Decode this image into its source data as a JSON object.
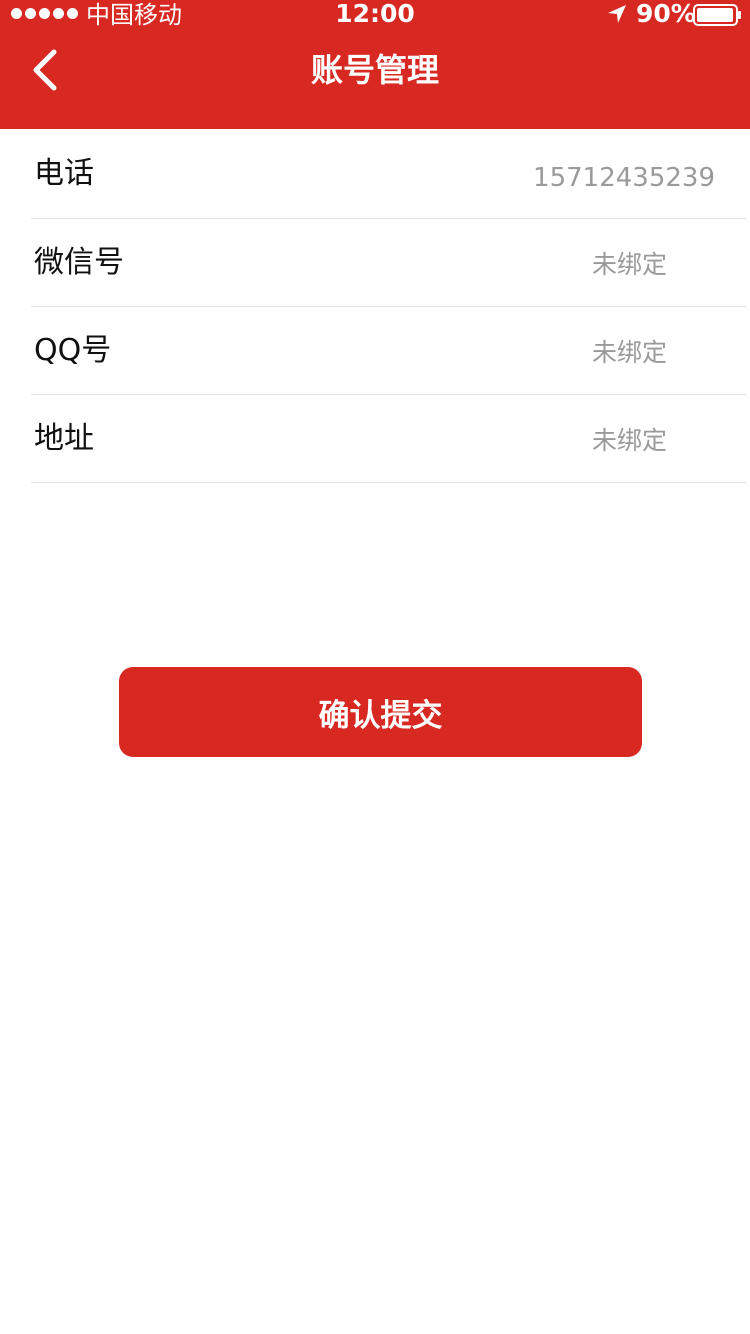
{
  "status_bar": {
    "carrier": "中国移动",
    "time": "12:00",
    "battery": "90%"
  },
  "nav": {
    "title": "账号管理",
    "back_icon": "chevron-left-icon"
  },
  "rows": [
    {
      "label": "电话",
      "value": "15712435239"
    },
    {
      "label": "微信号",
      "value": "未绑定"
    },
    {
      "label": "QQ号",
      "value": "未绑定"
    },
    {
      "label": "地址",
      "value": "未绑定"
    }
  ],
  "submit": {
    "label": "确认提交"
  },
  "colors": {
    "brand": "#d82822",
    "label": "#111111",
    "value": "#9a9a9a",
    "divider": "#e3e3e3"
  }
}
